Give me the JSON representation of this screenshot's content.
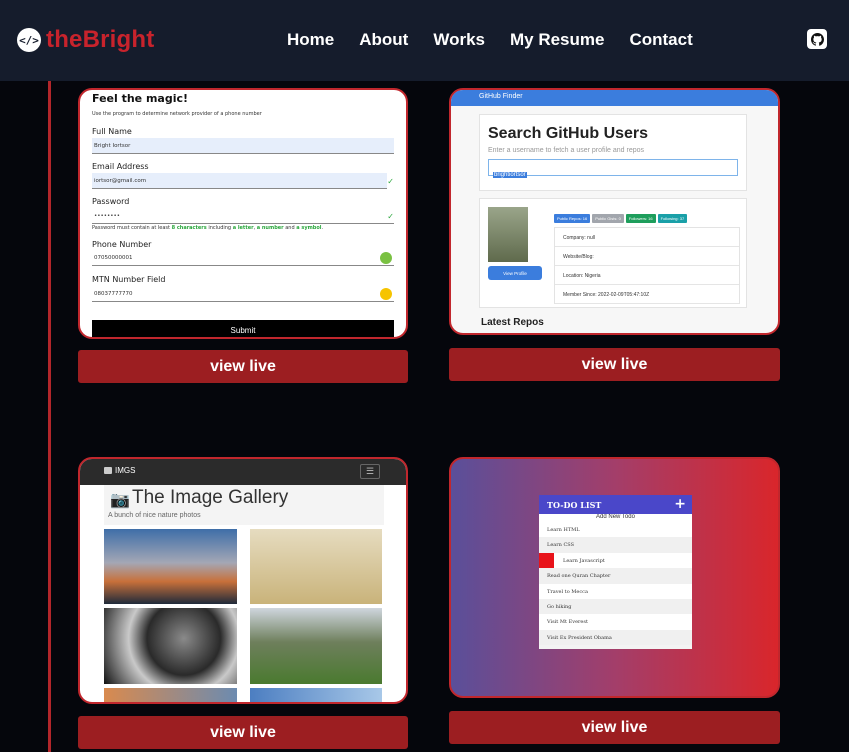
{
  "brand": {
    "logo_glyph": "</>",
    "name": "theBright",
    "color": "#c8232c"
  },
  "nav": {
    "items": [
      "Home",
      "About",
      "Works",
      "My Resume",
      "Contact"
    ],
    "github_icon": "github-icon"
  },
  "colors": {
    "background": "#05060c",
    "nav_bg": "#151c2c",
    "accent": "#c1272d",
    "button": "#9c1e21"
  },
  "view_live_label": "view live",
  "projects": {
    "network": {
      "title": "Feel the magic!",
      "subtitle": "Use the program to determine network provider of a phone number",
      "fields": [
        {
          "label": "Full Name",
          "value": "Bright Iortsor"
        },
        {
          "label": "Email Address",
          "value": "iortsor@gmail.com"
        },
        {
          "label": "Password",
          "value": "••••••••"
        },
        {
          "label": "Phone Number",
          "value": "07050000001"
        },
        {
          "label": "MTN Number Field",
          "value": "08037777770"
        }
      ],
      "password_hint_start": "Password must contain at least ",
      "password_hint_chars": "8 characters",
      "password_hint_mid": " including ",
      "password_hint_letter": "a letter",
      "password_hint_comma": ", ",
      "password_hint_number": "a number",
      "password_hint_and": " and ",
      "password_hint_symbol": "a symbol",
      "password_hint_end": ".",
      "submit": "Submit"
    },
    "github": {
      "top_bar": "GitHub Finder",
      "heading": "Search GitHub Users",
      "subheading": "Enter a username to fetch a user profile and repos",
      "search_value": "brightiortsor",
      "badges": [
        "Public Repos: 16",
        "Public Gists: 0",
        "Followers: 16",
        "Following: 37"
      ],
      "details": [
        "Company: null",
        "Website/Blog:",
        "Location: Nigeria",
        "Member Since: 2022-02-09T05:47:10Z"
      ],
      "view_profile": "View Profile",
      "latest_repos": "Latest Repos"
    },
    "gallery": {
      "brand": "IMGS",
      "heading": "The Image Gallery",
      "subheading": "A bunch of nice nature photos"
    },
    "todo": {
      "header": "TO-DO LIST",
      "add_label": "Add New Todo",
      "items": [
        "Learn HTML",
        "Learn CSS",
        "Learn Javascript",
        "Read one Quran Chapter",
        "Travel to Mecca",
        "Go hiking",
        "Visit Mt Everest",
        "Visit Ex President Obama"
      ]
    }
  }
}
